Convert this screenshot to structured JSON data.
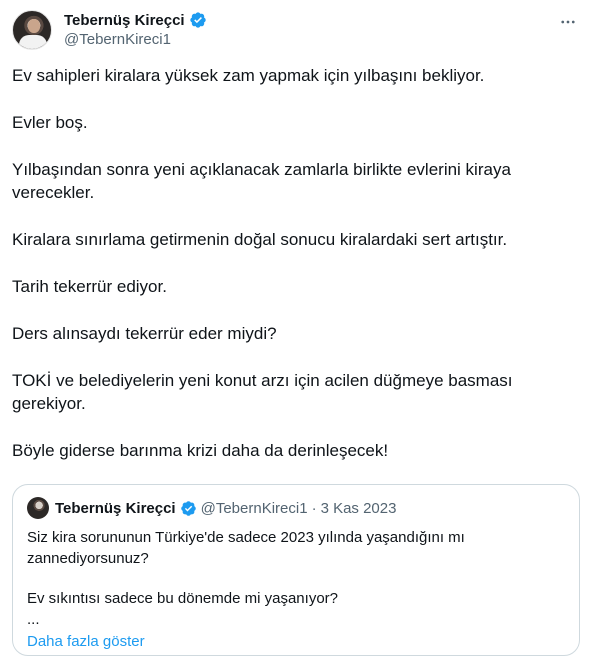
{
  "author": {
    "name": "Tebernüş Kireçci",
    "handle": "@TebernKireci1"
  },
  "tweet": {
    "paragraphs": [
      "Ev sahipleri kiralara yüksek zam yapmak için yılbaşını bekliyor.",
      "Evler boş.",
      "Yılbaşından sonra yeni açıklanacak zamlarla birlikte evlerini kiraya verecekler.",
      "Kiralara sınırlama getirmenin doğal sonucu kiralardaki sert artıştır.",
      "Tarih tekerrür ediyor.",
      "Ders alınsaydı tekerrür eder miydi?",
      "TOKİ ve belediyelerin yeni konut arzı için acilen düğmeye basması gerekiyor.",
      "Böyle giderse barınma krizi daha da derinleşecek!"
    ]
  },
  "quote": {
    "name": "Tebernüş Kireçci",
    "handle": "@TebernKireci1",
    "separator": "·",
    "date": "3 Kas 2023",
    "paragraphs": [
      "Siz kira sorununun Türkiye'de sadece 2023 yılında yaşandığını mı zannediyorsunuz?",
      "Ev sıkıntısı sadece bu dönemde mi yaşanıyor?",
      "..."
    ],
    "show_more": "Daha fazla göster"
  },
  "icons": {
    "verified": "verified-badge-icon",
    "more": "more-horizontal-icon"
  },
  "colors": {
    "verified": "#1d9bf0",
    "link": "#1d9bf0",
    "secondary_text": "#536471",
    "border": "#cfd9de"
  }
}
